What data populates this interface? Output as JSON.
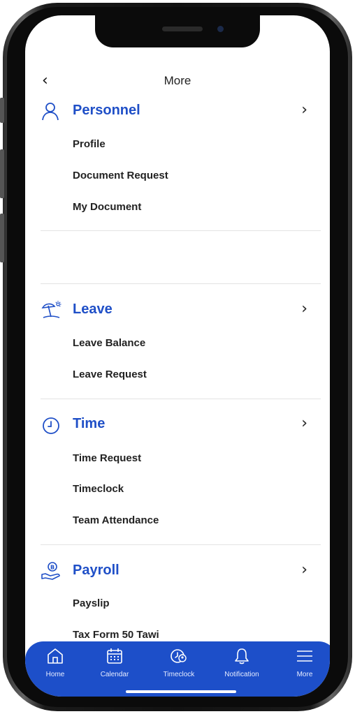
{
  "header": {
    "back_icon": "chevron-left-icon",
    "title": "More"
  },
  "sections": [
    {
      "title": "Personnel",
      "icon": "person-icon",
      "items": [
        "Profile",
        "Document Request",
        "My Document"
      ]
    },
    {
      "title": "Leave",
      "icon": "beach-umbrella-icon",
      "items": [
        "Leave Balance",
        "Leave Request"
      ]
    },
    {
      "title": "Time",
      "icon": "clock-icon",
      "items": [
        "Time Request",
        "Timeclock",
        "Team Attendance"
      ]
    },
    {
      "title": "Payroll",
      "icon": "hand-coin-icon",
      "items": [
        "Payslip",
        "Tax Form 50 Tawi"
      ]
    }
  ],
  "tabbar": {
    "tabs": [
      {
        "label": "Home",
        "icon": "home-icon"
      },
      {
        "label": "Calendar",
        "icon": "calendar-icon"
      },
      {
        "label": "Timeclock",
        "icon": "timeclock-icon"
      },
      {
        "label": "Notification",
        "icon": "bell-icon"
      },
      {
        "label": "More",
        "icon": "menu-icon"
      }
    ]
  },
  "colors": {
    "accent": "#1f4fc7",
    "tabbar": "#1d4fc9"
  }
}
